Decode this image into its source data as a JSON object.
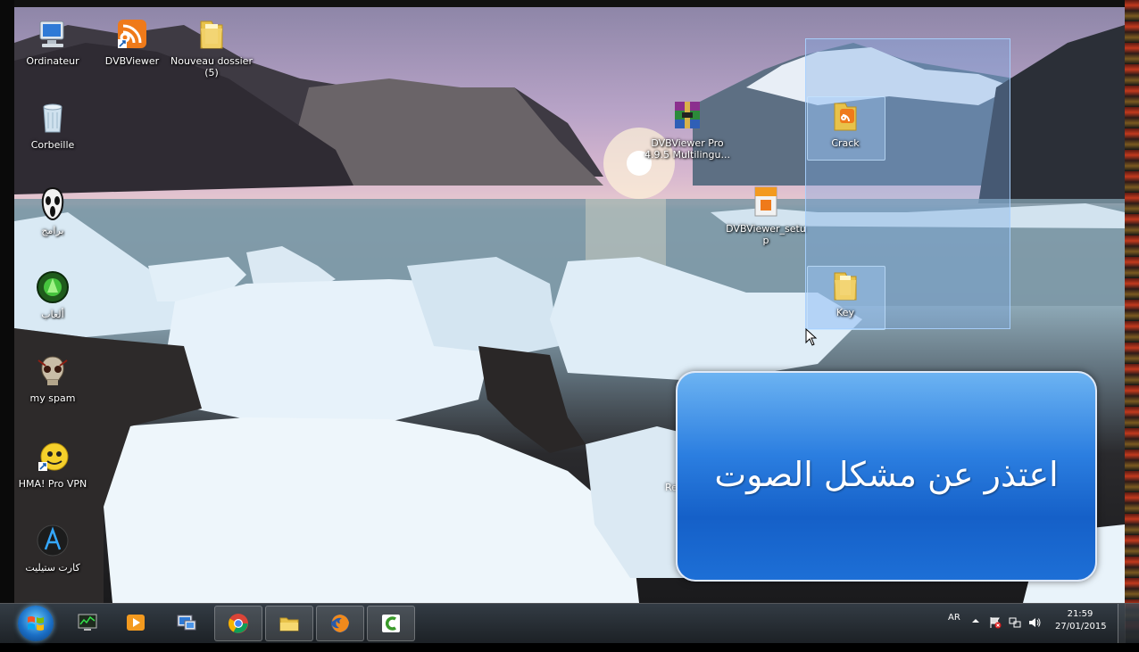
{
  "desktop_icons": [
    {
      "label": "Ordinateur",
      "icon": "computer-icon"
    },
    {
      "label": "DVBViewer",
      "icon": "dvbviewer-shortcut-icon"
    },
    {
      "label": "Nouveau dossier\n(5)",
      "icon": "folder-icon"
    },
    {
      "label": "Corbeille",
      "icon": "recycle-bin-icon"
    },
    {
      "label": "برامج",
      "icon": "ghost-mask-icon"
    },
    {
      "label": "ألعاب",
      "icon": "game-orb-icon"
    },
    {
      "label": "my spam",
      "icon": "skull-icon"
    },
    {
      "label": "HMA! Pro VPN",
      "icon": "hma-vpn-icon"
    },
    {
      "label": "كارت ستيليت",
      "icon": "satellite-card-icon"
    },
    {
      "label": "DVBViewer Pro\n4.9.5 Multilingu...",
      "icon": "winrar-archive-icon"
    },
    {
      "label": "DVBViewer_setup",
      "icon": "setup-installer-icon"
    },
    {
      "label": "Crack",
      "icon": "crack-folder-icon"
    },
    {
      "label": "Key",
      "icon": "key-folder-icon"
    },
    {
      "label": "Re",
      "icon": ""
    }
  ],
  "banner": {
    "text": "اعتذر عن مشكل الصوت"
  },
  "taskbar": {
    "apps": [
      "start-button",
      "task-manager",
      "media-player",
      "remote-desktop",
      "chrome",
      "file-explorer",
      "firefox",
      "camtasia"
    ],
    "language": "AR",
    "time": "21:59",
    "date": "27/01/2015"
  },
  "colors": {
    "banner_top": "#6cb3f2",
    "banner_bottom": "#1560c8",
    "selection": "#78aae6"
  }
}
